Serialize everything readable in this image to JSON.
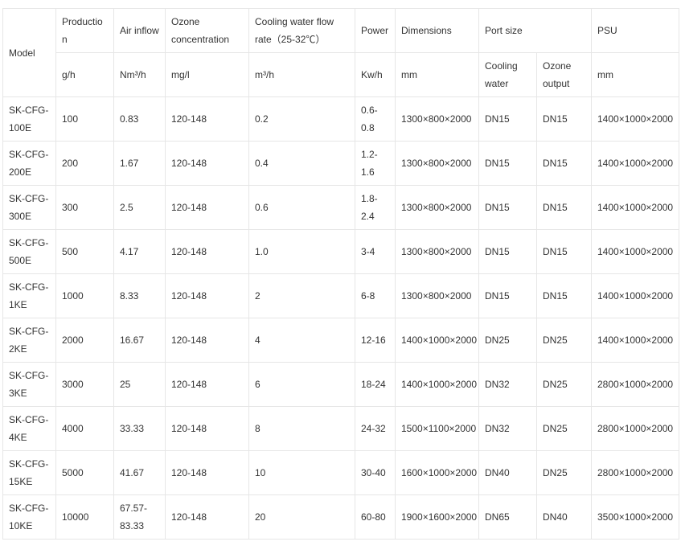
{
  "header": {
    "model": "Model",
    "production": "Production",
    "air_inflow": "Air inflow",
    "ozone_concentration": "Ozone concentration",
    "cooling_water_flow": "Cooling water flow rate（25-32℃）",
    "power": "Power",
    "dimensions": "Dimensions",
    "port_size": "Port size",
    "psu": "PSU"
  },
  "units": {
    "production": "g/h",
    "air_inflow": "Nm³/h",
    "ozone_concentration": "mg/l",
    "cooling_water_flow": "m³/h",
    "power": "Kw/h",
    "dimensions": "mm",
    "port_cooling_water": "Cooling water",
    "port_ozone_output": "Ozone output",
    "psu": "mm"
  },
  "rows": [
    {
      "model": "SK-CFG-100E",
      "production": "100",
      "air": "0.83",
      "ozone": "120-148",
      "cooling": "0.2",
      "power": "0.6-0.8",
      "dimensions": "1300×800×2000",
      "port_cooling": "DN15",
      "port_ozone": "DN15",
      "psu": "1400×1000×2000"
    },
    {
      "model": "SK-CFG-200E",
      "production": "200",
      "air": "1.67",
      "ozone": "120-148",
      "cooling": "0.4",
      "power": "1.2-1.6",
      "dimensions": "1300×800×2000",
      "port_cooling": "DN15",
      "port_ozone": "DN15",
      "psu": "1400×1000×2000"
    },
    {
      "model": "SK-CFG-300E",
      "production": "300",
      "air": "2.5",
      "ozone": "120-148",
      "cooling": "0.6",
      "power": "1.8-2.4",
      "dimensions": "1300×800×2000",
      "port_cooling": "DN15",
      "port_ozone": "DN15",
      "psu": "1400×1000×2000"
    },
    {
      "model": "SK-CFG-500E",
      "production": "500",
      "air": "4.17",
      "ozone": "120-148",
      "cooling": "1.0",
      "power": "3-4",
      "dimensions": "1300×800×2000",
      "port_cooling": "DN15",
      "port_ozone": "DN15",
      "psu": "1400×1000×2000"
    },
    {
      "model": "SK-CFG-1KE",
      "production": "1000",
      "air": "8.33",
      "ozone": "120-148",
      "cooling": "2",
      "power": "6-8",
      "dimensions": "1300×800×2000",
      "port_cooling": "DN15",
      "port_ozone": "DN15",
      "psu": "1400×1000×2000"
    },
    {
      "model": "SK-CFG-2KE",
      "production": "2000",
      "air": "16.67",
      "ozone": "120-148",
      "cooling": "4",
      "power": "12-16",
      "dimensions": "1400×1000×2000",
      "port_cooling": "DN25",
      "port_ozone": "DN25",
      "psu": "1400×1000×2000"
    },
    {
      "model": "SK-CFG-3KE",
      "production": "3000",
      "air": "25",
      "ozone": "120-148",
      "cooling": "6",
      "power": "18-24",
      "dimensions": "1400×1000×2000",
      "port_cooling": "DN32",
      "port_ozone": "DN25",
      "psu": "2800×1000×2000"
    },
    {
      "model": "SK-CFG-4KE",
      "production": "4000",
      "air": "33.33",
      "ozone": "120-148",
      "cooling": "8",
      "power": "24-32",
      "dimensions": "1500×1100×2000",
      "port_cooling": "DN32",
      "port_ozone": "DN25",
      "psu": "2800×1000×2000"
    },
    {
      "model": "SK-CFG-15KE",
      "production": "5000",
      "air": "41.67",
      "ozone": "120-148",
      "cooling": "10",
      "power": "30-40",
      "dimensions": "1600×1000×2000",
      "port_cooling": "DN40",
      "port_ozone": "DN25",
      "psu": "2800×1000×2000"
    },
    {
      "model": "SK-CFG-10KE",
      "production": "10000",
      "air": "67.57-83.33",
      "ozone": "120-148",
      "cooling": "20",
      "power": "60-80",
      "dimensions": "1900×1600×2000",
      "port_cooling": "DN65",
      "port_ozone": "DN40",
      "psu": "3500×1000×2000"
    }
  ]
}
